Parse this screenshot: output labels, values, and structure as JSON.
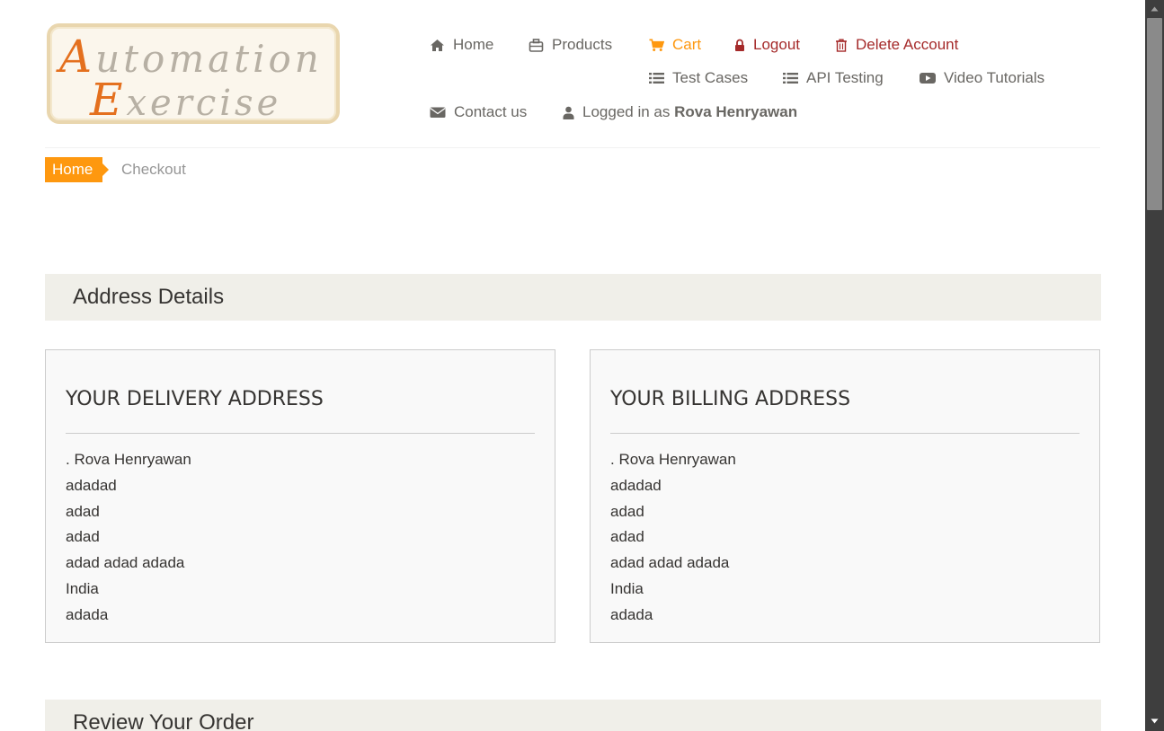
{
  "logo": {
    "line1_cap": "A",
    "line1_rest": "utomation",
    "line2_cap": "E",
    "line2_rest": "xercise"
  },
  "nav": {
    "home": "Home",
    "products": "Products",
    "cart": "Cart",
    "logout": "Logout",
    "delete_account": "Delete Account",
    "test_cases": "Test Cases",
    "api_testing": "API Testing",
    "video_tutorials": "Video Tutorials",
    "contact_us": "Contact us",
    "logged_in_prefix": "Logged in as",
    "username": "Rova Henryawan"
  },
  "breadcrumb": {
    "home": "Home",
    "current": "Checkout"
  },
  "sections": {
    "address_details": "Address Details",
    "review_order": "Review Your Order"
  },
  "delivery_address": {
    "title": "YOUR DELIVERY ADDRESS",
    "lines": [
      ". Rova Henryawan",
      "adadad",
      "adad",
      "adad",
      "adad adad adada",
      "India",
      "adada"
    ]
  },
  "billing_address": {
    "title": "YOUR BILLING ADDRESS",
    "lines": [
      ". Rova Henryawan",
      "adadad",
      "adad",
      "adad",
      "adad adad adada",
      "India",
      "adada"
    ]
  },
  "colors": {
    "accent": "#fe980f",
    "danger": "#a52a2a",
    "text": "#696763",
    "section_bg": "#f0efe9"
  },
  "icons": {
    "home": "home-icon",
    "products": "briefcase-icon",
    "cart": "shopping-cart-icon",
    "logout": "lock-icon",
    "delete": "trash-icon",
    "test_cases": "list-icon",
    "api_testing": "list-icon",
    "video": "youtube-play-icon",
    "contact": "envelope-icon",
    "user": "user-icon"
  }
}
